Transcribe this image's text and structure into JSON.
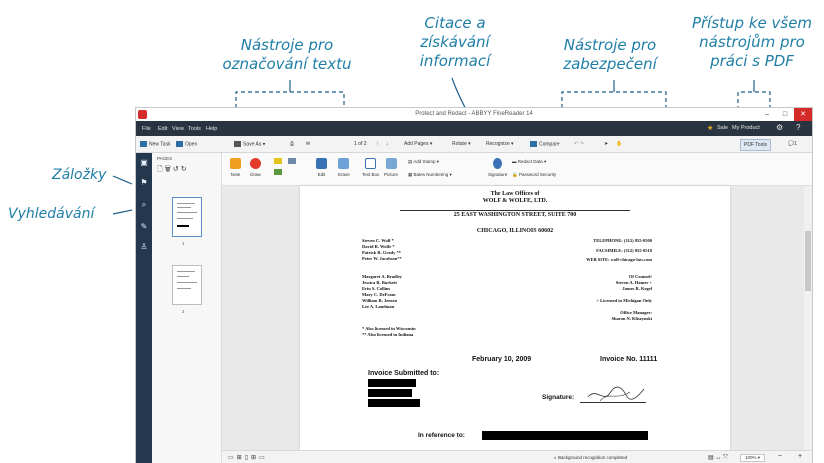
{
  "callouts": {
    "text_markup": "Nástroje pro označování textu",
    "citation": "Citace a získávání informací",
    "security": "Nástroje pro zabezpečení",
    "all_tools": "Přístup ke všem nástrojům pro práci s PDF",
    "bookmarks": "Záložky",
    "search": "Vyhledávání"
  },
  "window": {
    "title": "Protect and Redact - ABBYY FineReader 14",
    "menu": [
      "File",
      "Edit",
      "View",
      "Tools",
      "Help"
    ],
    "sale": "Sale",
    "product": "My Product"
  },
  "toolbar": {
    "new_task": "New Task",
    "open": "Open",
    "save_as": "Save As",
    "page": "1 of 2",
    "add_pages": "Add Pages",
    "rotate": "Rotate",
    "recognize": "Recognize",
    "compare": "Compare",
    "pdf_tools": "PDF Tools",
    "comments_count": "1"
  },
  "pages_panel": {
    "header": "PAGES",
    "thumb1": "1",
    "thumb2": "2"
  },
  "ribbon": {
    "note": "Note",
    "draw": "Draw",
    "edit": "Edit",
    "erase": "Erase",
    "text_box": "Text Box",
    "picture": "Picture",
    "add_stamp": "Add Stamp",
    "bates_numbering": "Bates Numbering",
    "signature": "Signature",
    "redact_data": "Redact Data",
    "password_security": "Password Security"
  },
  "document": {
    "firm_line1": "The Law Offices of",
    "firm_line2": "WOLF & WOLFE, LTD.",
    "address": "25 EAST WASHINGTON STREET, SUITE 700",
    "city": "CHICAGO, ILLINOIS 60602",
    "names_left": [
      "Steven C. Wolf *",
      "David R. Wolfe *",
      "Patrick R. Grady **",
      "Peter W. Jacobson**"
    ],
    "phone": "TELEPHONE: (312) 855-0500",
    "fax": "FACSIMILE: (312) 855-0510",
    "web": "WEB SITE: wolf-chicago-law.com",
    "names_left2": [
      "Margaret A. Bradley",
      "Jessica R. Burkett",
      "Erin S. Collins",
      "Mary C. DeFranc",
      "William R. Jensen",
      "Lee A. Landman"
    ],
    "of_counsel": "Of Counsel:",
    "counsel_names": [
      "Steven A. Hamer +",
      "James R. Kegel"
    ],
    "licensed_mi": "+ Licensed in Michigan Only",
    "office_manager": "Office Manager:",
    "manager_name": "Sharon N. Kliszynski",
    "note_wi": "*  Also licensed in Wisconsin",
    "note_in": "** Also licensed in Indiana",
    "date": "February 10, 2009",
    "invoice_no": "Invoice No. 11111",
    "invoice_submitted": "Invoice Submitted to:",
    "signature_label": "Signature:",
    "in_reference": "In reference to:"
  },
  "status": {
    "recognition": "Background recognition completed",
    "zoom": "100%"
  },
  "colors": {
    "callout": "#1f7ea6",
    "menubar": "#2a3440",
    "leftbar": "#23374f",
    "close": "#d42a2a"
  }
}
